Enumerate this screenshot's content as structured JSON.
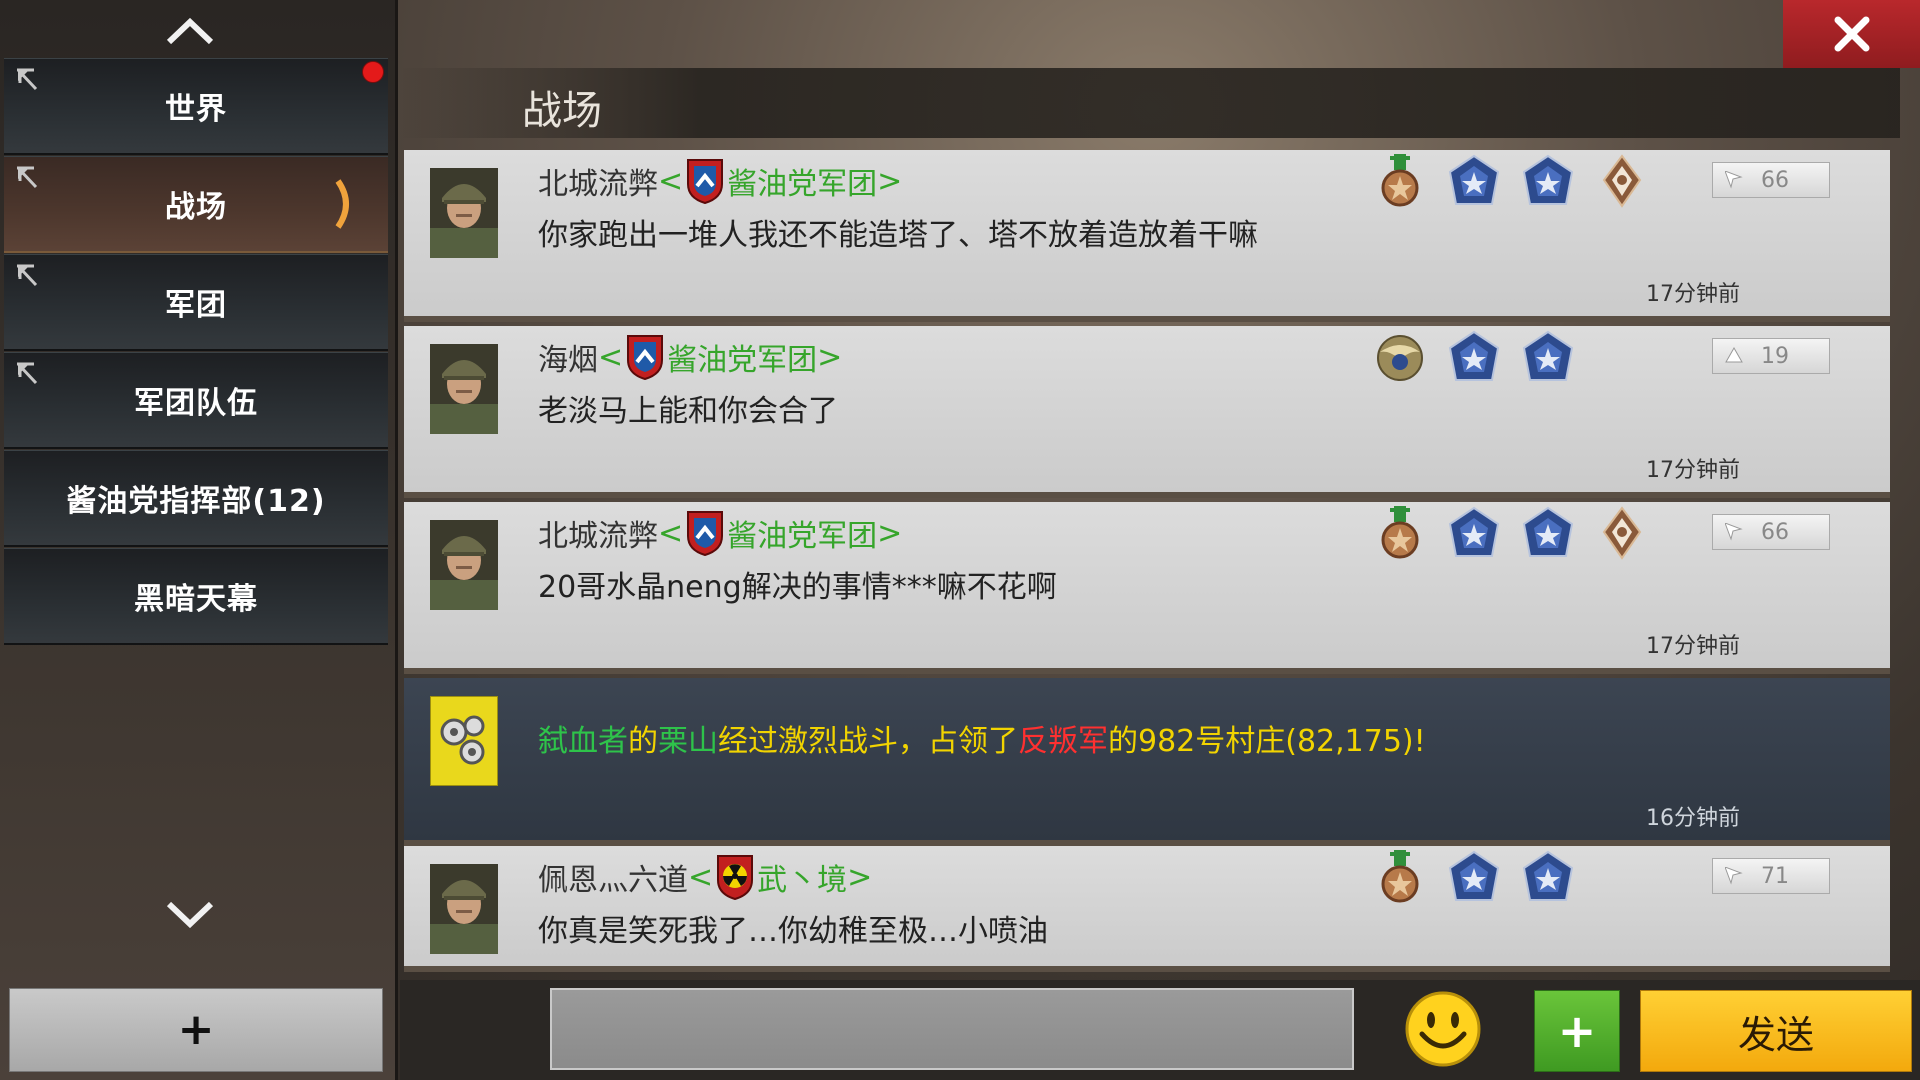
{
  "sidebar": {
    "items": [
      {
        "label": "世界",
        "pinned": true,
        "unread": true,
        "active": false
      },
      {
        "label": "战场",
        "pinned": true,
        "unread": false,
        "active": true
      },
      {
        "label": "军团",
        "pinned": true,
        "unread": false,
        "active": false
      },
      {
        "label": "军团队伍",
        "pinned": true,
        "unread": false,
        "active": false
      },
      {
        "label": "酱油党指挥部(12)",
        "pinned": false,
        "unread": false,
        "active": false
      },
      {
        "label": "黑暗天幕",
        "pinned": false,
        "unread": false,
        "active": false
      }
    ],
    "add_label": "+"
  },
  "channel": {
    "title": "战场"
  },
  "messages": [
    {
      "sender": "北城流弊",
      "guild_open": "<",
      "guild": "酱油党军团",
      "guild_close": ">",
      "text": "你家跑出一堆人我还不能造塔了、塔不放着造放着干嘛",
      "level": "66",
      "time": "17分钟前",
      "badges": [
        "star-medal-icon",
        "blue-rank-icon",
        "blue-rank-icon",
        "bronze-diamond-icon"
      ]
    },
    {
      "sender": "海烟",
      "guild_open": "<",
      "guild": "酱油党军团",
      "guild_close": ">",
      "text": "老淡马上能和你会合了",
      "level": "19",
      "time": "17分钟前",
      "badges": [
        "eagle-emblem-icon",
        "blue-rank-icon",
        "blue-rank-icon"
      ]
    },
    {
      "sender": "北城流弊",
      "guild_open": "<",
      "guild": "酱油党军团",
      "guild_close": ">",
      "text": "20哥水晶neng解决的事情***嘛不花啊",
      "level": "66",
      "time": "17分钟前",
      "badges": [
        "star-medal-icon",
        "blue-rank-icon",
        "blue-rank-icon",
        "bronze-diamond-icon"
      ]
    },
    {
      "system": true,
      "parts": [
        {
          "text": "弑血者",
          "color": "green"
        },
        {
          "text": "的",
          "color": "yellow"
        },
        {
          "text": "栗山",
          "color": "green"
        },
        {
          "text": "经过激烈战斗，占领了",
          "color": "yellow"
        },
        {
          "text": "反叛军",
          "color": "red"
        },
        {
          "text": "的982号村庄(82,175)!",
          "color": "yellow"
        }
      ],
      "time": "16分钟前"
    },
    {
      "sender": "佩恩灬六道",
      "guild_open": "<",
      "guild": "武丶境",
      "guild_close": ">",
      "text": "你真是笑死我了…你幼稚至极…小喷油",
      "level": "71",
      "time": "",
      "badges": [
        "star-medal-icon",
        "blue-rank-icon",
        "blue-rank-icon"
      ]
    }
  ],
  "input": {
    "placeholder": ""
  },
  "buttons": {
    "plus": "+",
    "send": "发送"
  }
}
